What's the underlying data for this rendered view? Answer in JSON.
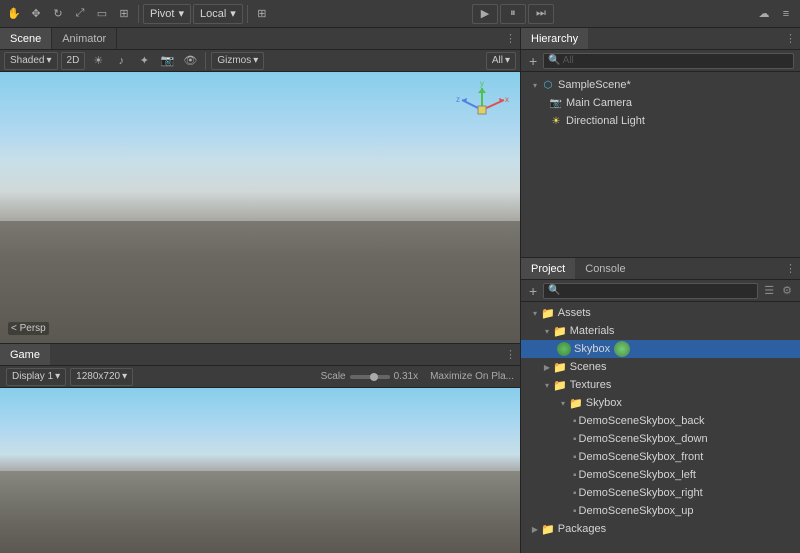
{
  "topToolbar": {
    "tools": [
      "hand",
      "move",
      "rotate",
      "scale",
      "rect",
      "transform"
    ],
    "pivot": "Pivot",
    "local": "Local",
    "playLabel": "▶",
    "pauseLabel": "⏸",
    "stepLabel": "⏭"
  },
  "sceneTabs": {
    "scene": "Scene",
    "animator": "Animator",
    "activeTab": "scene"
  },
  "sceneToolbar": {
    "shaded": "Shaded",
    "twoD": "2D",
    "gizmos": "Gizmos",
    "all": "All"
  },
  "sceneView": {
    "perspLabel": "< Persp"
  },
  "gameTabs": {
    "game": "Game",
    "activeTab": "game"
  },
  "gameToolbar": {
    "display": "Display 1",
    "resolution": "1280x720",
    "scale": "Scale",
    "scaleValue": "0.31x",
    "maximizeOnPlay": "Maximize On Pla..."
  },
  "hierarchyPanel": {
    "title": "Hierarchy",
    "plusButton": "+",
    "allLabel": "All",
    "searchPlaceholder": "",
    "items": [
      {
        "id": "samplescene",
        "label": "SampleScene*",
        "indent": 0,
        "type": "scene",
        "expanded": true
      },
      {
        "id": "maincamera",
        "label": "Main Camera",
        "indent": 1,
        "type": "camera"
      },
      {
        "id": "directionallight",
        "label": "Directional Light",
        "indent": 1,
        "type": "light"
      }
    ]
  },
  "projectPanel": {
    "projectTab": "Project",
    "consoleTab": "Console",
    "activeTab": "project",
    "plusButton": "+",
    "searchPlaceholder": "",
    "tree": [
      {
        "id": "assets",
        "label": "Assets",
        "indent": 0,
        "type": "folder",
        "expanded": true
      },
      {
        "id": "materials",
        "label": "Materials",
        "indent": 1,
        "type": "folder",
        "expanded": true
      },
      {
        "id": "skybox",
        "label": "Skybox",
        "indent": 2,
        "type": "skybox",
        "selected": true
      },
      {
        "id": "scenes",
        "label": "Scenes",
        "indent": 1,
        "type": "folder",
        "expanded": false
      },
      {
        "id": "textures",
        "label": "Textures",
        "indent": 1,
        "type": "folder",
        "expanded": true
      },
      {
        "id": "skybox-folder",
        "label": "Skybox",
        "indent": 2,
        "type": "folder",
        "expanded": true
      },
      {
        "id": "demo-back",
        "label": "DemoSceneSkybox_back",
        "indent": 3,
        "type": "file"
      },
      {
        "id": "demo-down",
        "label": "DemoSceneSkybox_down",
        "indent": 3,
        "type": "file"
      },
      {
        "id": "demo-front",
        "label": "DemoSceneSkybox_front",
        "indent": 3,
        "type": "file"
      },
      {
        "id": "demo-left",
        "label": "DemoSceneSkybox_left",
        "indent": 3,
        "type": "file"
      },
      {
        "id": "demo-right",
        "label": "DemoSceneSkybox_right",
        "indent": 3,
        "type": "file"
      },
      {
        "id": "demo-up",
        "label": "DemoSceneSkybox_up",
        "indent": 3,
        "type": "file"
      },
      {
        "id": "packages",
        "label": "Packages",
        "indent": 0,
        "type": "folder",
        "expanded": false
      }
    ]
  },
  "colors": {
    "selectedBlue": "#2d5fa3",
    "folderOrange": "#c8a030",
    "skyboxGreen": "#60c060",
    "tabActive": "#4a4a4a"
  }
}
